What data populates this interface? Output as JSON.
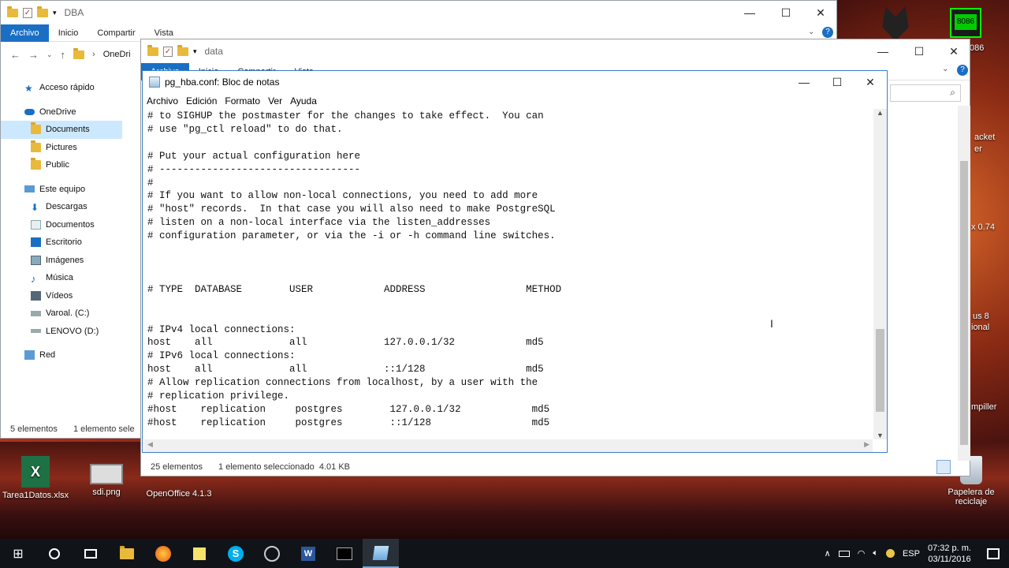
{
  "explorer_back": {
    "title": "DBA",
    "ribbon_tabs": [
      "Archivo",
      "Inicio",
      "Compartir",
      "Vista"
    ],
    "breadcrumb": "OneDri",
    "sidebar": [
      {
        "label": "Acceso rápido",
        "icon": "star-icon",
        "indent": false
      },
      {
        "label": "OneDrive",
        "icon": "cloud-icon",
        "indent": false
      },
      {
        "label": "Documents",
        "icon": "folder-icon",
        "indent": true,
        "selected": true
      },
      {
        "label": "Pictures",
        "icon": "folder-icon",
        "indent": true
      },
      {
        "label": "Public",
        "icon": "folder-icon",
        "indent": true
      },
      {
        "label": "Este equipo",
        "icon": "computer-icon",
        "indent": false
      },
      {
        "label": "Descargas",
        "icon": "download-icon",
        "indent": true
      },
      {
        "label": "Documentos",
        "icon": "documents-icon",
        "indent": true
      },
      {
        "label": "Escritorio",
        "icon": "desktop-icon",
        "indent": true
      },
      {
        "label": "Imágenes",
        "icon": "images-icon",
        "indent": true
      },
      {
        "label": "Música",
        "icon": "music-icon",
        "indent": true
      },
      {
        "label": "Vídeos",
        "icon": "video-icon",
        "indent": true
      },
      {
        "label": "Varoal. (C:)",
        "icon": "drive-icon",
        "indent": true
      },
      {
        "label": "LENOVO (D:)",
        "icon": "drive-icon",
        "indent": true
      },
      {
        "label": "Red",
        "icon": "network-icon",
        "indent": false
      }
    ],
    "status_count": "5 elementos",
    "status_sel": "1 elemento sele"
  },
  "explorer_front": {
    "title": "data",
    "ribbon_tabs": [
      "Archivo",
      "Inicio",
      "Compartir",
      "Vista"
    ],
    "status_count": "25 elementos",
    "status_sel": "1 elemento seleccionado",
    "status_size": "4.01 KB"
  },
  "notepad": {
    "title": "pg_hba.conf: Bloc de notas",
    "menu": [
      "Archivo",
      "Edición",
      "Formato",
      "Ver",
      "Ayuda"
    ],
    "content": "# to SIGHUP the postmaster for the changes to take effect.  You can\n# use \"pg_ctl reload\" to do that.\n\n# Put your actual configuration here\n# ----------------------------------\n#\n# If you want to allow non-local connections, you need to add more\n# \"host\" records.  In that case you will also need to make PostgreSQL\n# listen on a non-local interface via the listen_addresses\n# configuration parameter, or via the -i or -h command line switches.\n\n\n\n# TYPE  DATABASE        USER            ADDRESS                 METHOD\n\n\n# IPv4 local connections:\nhost    all             all             127.0.0.1/32            md5\n# IPv6 local connections:\nhost    all             all             ::1/128                 md5\n# Allow replication connections from localhost, by a user with the\n# replication privilege.\n#host    replication     postgres        127.0.0.1/32            md5\n#host    replication     postgres        ::1/128                 md5",
    "scroll_position_fraction": 0.92
  },
  "desktop_icons": [
    {
      "label": "Tarea1Datos.xlsx",
      "icon": "excel-icon"
    },
    {
      "label": "sdi.png",
      "icon": "image-file-icon"
    },
    {
      "label": "OpenOffice 4.1.3",
      "icon": "openoffice-icon"
    },
    {
      "label": "Papelera de reciclaje",
      "icon": "recycle-bin-icon"
    }
  ],
  "desktop_right_labels": [
    "8086",
    "acket",
    "er",
    "x 0.74",
    "us 8",
    "ional",
    "mpiller"
  ],
  "taskbar": {
    "apps": [
      "start-icon",
      "cortana-icon",
      "task-view-icon",
      "file-explorer-icon",
      "firefox-icon",
      "sticky-notes-icon",
      "skype-icon",
      "steam-icon",
      "word-icon",
      "terminal-icon",
      "notepad-icon"
    ],
    "language": "ESP",
    "time": "07:32 p. m.",
    "date": "03/11/2016"
  }
}
